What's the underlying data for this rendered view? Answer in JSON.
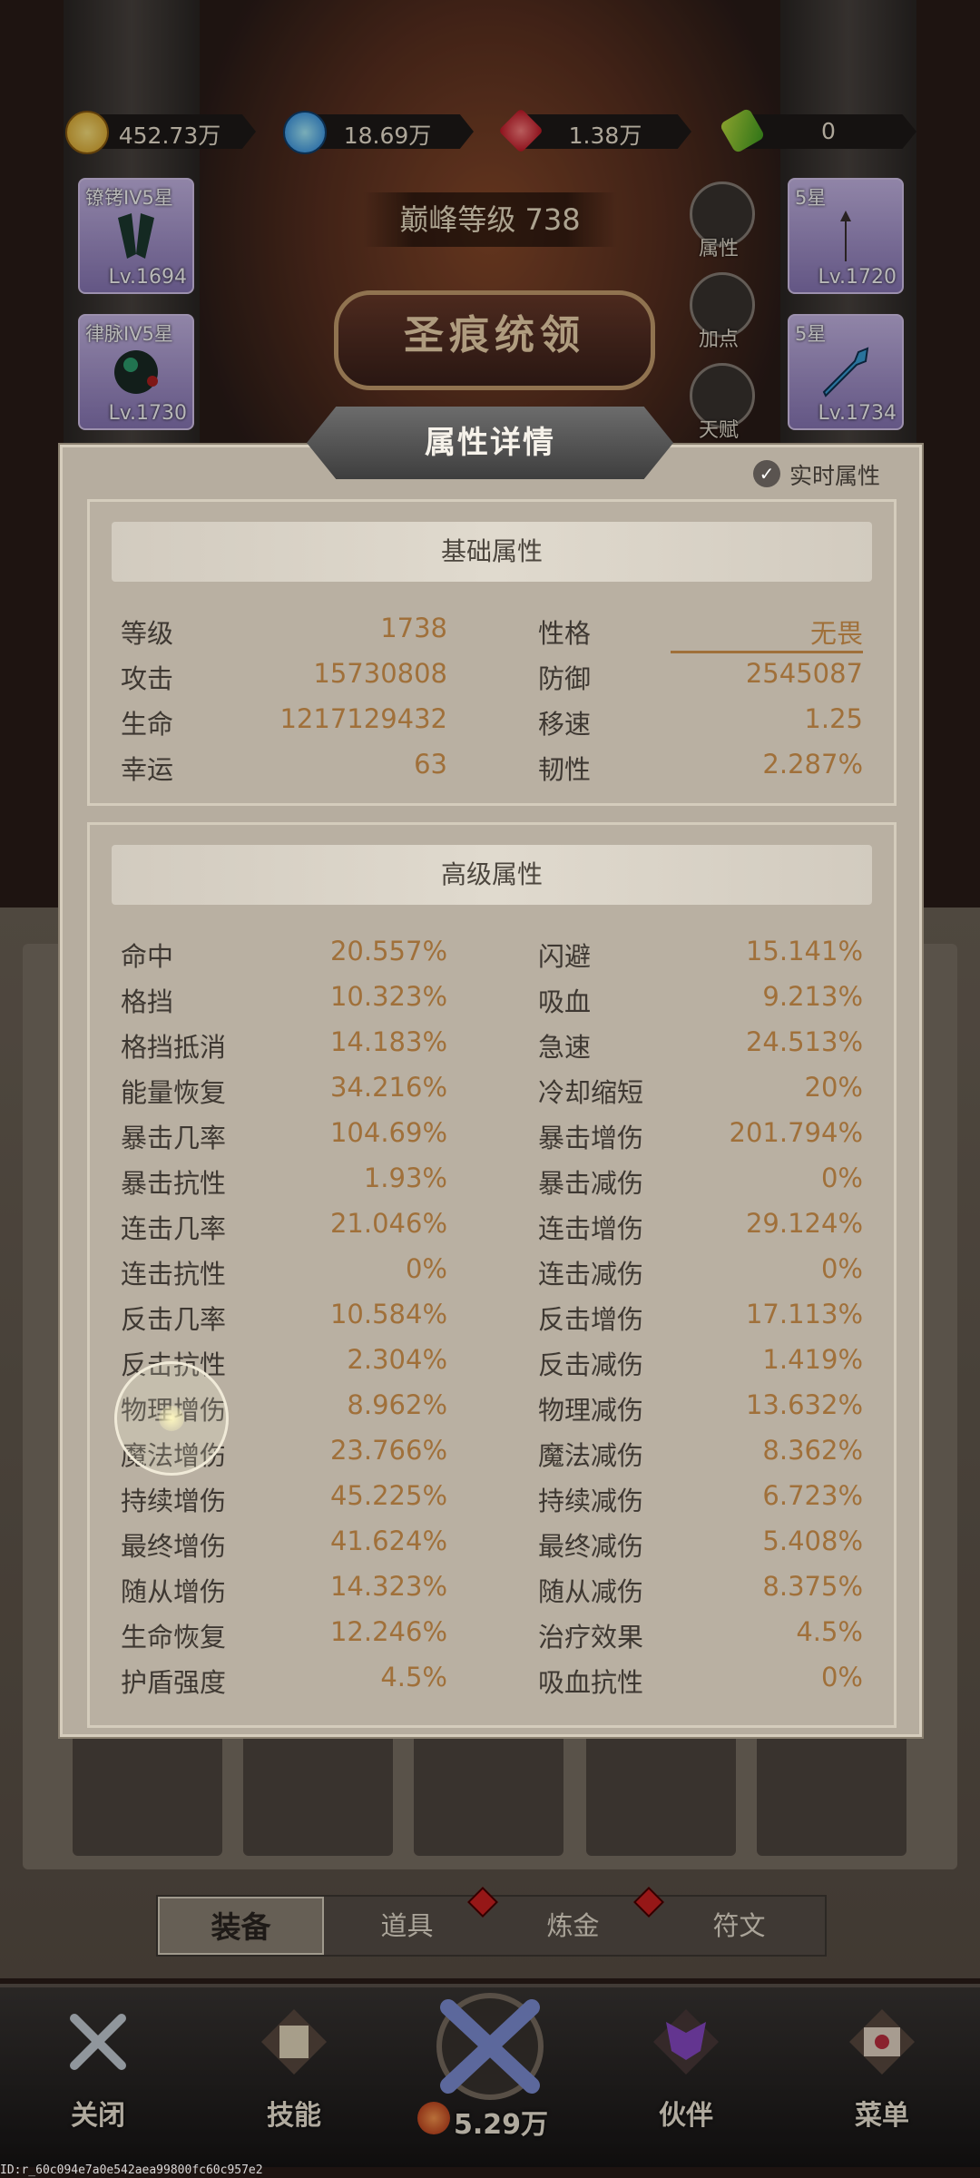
{
  "colors": {
    "panel_bg": "#b6ad9f",
    "value_text": "#a0703a",
    "label_text": "#3e3832",
    "tab_active": "#8e8476",
    "badge_red": "#d02020"
  },
  "currencies": [
    {
      "icon": "gold-coin-icon",
      "value": "452.73万"
    },
    {
      "icon": "blue-gem-icon",
      "value": "18.69万"
    },
    {
      "icon": "red-ruby-icon",
      "value": "1.38万"
    },
    {
      "icon": "green-ticket-icon",
      "value": "0"
    }
  ],
  "hero": {
    "peak_level": "巅峰等级 738",
    "title_badge": "圣痕统领",
    "gear_left": [
      {
        "title": "镣铐IV5星",
        "level": "Lv.1694"
      },
      {
        "title": "律脉IV5星",
        "level": "Lv.1730"
      }
    ],
    "gear_right": [
      {
        "title": "5星",
        "level": "Lv.1720"
      },
      {
        "title": "5星",
        "level": "Lv.1734"
      }
    ],
    "side_buttons": [
      {
        "label": "属性",
        "icon": "attribute-icon"
      },
      {
        "label": "加点",
        "icon": "fist-icon"
      },
      {
        "label": "天赋",
        "icon": "talent-tree-icon"
      }
    ]
  },
  "panel": {
    "title": "属性详情",
    "realtime_label": "实时属性",
    "basic": {
      "title": "基础属性",
      "rows": [
        {
          "k1": "等级",
          "v1": "1738",
          "k2": "性格",
          "v2": "无畏"
        },
        {
          "k1": "攻击",
          "v1": "15730808",
          "k2": "防御",
          "v2": "2545087"
        },
        {
          "k1": "生命",
          "v1": "1217129432",
          "k2": "移速",
          "v2": "1.25"
        },
        {
          "k1": "幸运",
          "v1": "63",
          "k2": "韧性",
          "v2": "2.287%"
        }
      ]
    },
    "advanced": {
      "title": "高级属性",
      "rows": [
        {
          "k1": "命中",
          "v1": "20.557%",
          "k2": "闪避",
          "v2": "15.141%"
        },
        {
          "k1": "格挡",
          "v1": "10.323%",
          "k2": "吸血",
          "v2": "9.213%"
        },
        {
          "k1": "格挡抵消",
          "v1": "14.183%",
          "k2": "急速",
          "v2": "24.513%"
        },
        {
          "k1": "能量恢复",
          "v1": "34.216%",
          "k2": "冷却缩短",
          "v2": "20%"
        },
        {
          "k1": "暴击几率",
          "v1": "104.69%",
          "k2": "暴击增伤",
          "v2": "201.794%"
        },
        {
          "k1": "暴击抗性",
          "v1": "1.93%",
          "k2": "暴击减伤",
          "v2": "0%"
        },
        {
          "k1": "连击几率",
          "v1": "21.046%",
          "k2": "连击增伤",
          "v2": "29.124%"
        },
        {
          "k1": "连击抗性",
          "v1": "0%",
          "k2": "连击减伤",
          "v2": "0%"
        },
        {
          "k1": "反击几率",
          "v1": "10.584%",
          "k2": "反击增伤",
          "v2": "17.113%"
        },
        {
          "k1": "反击抗性",
          "v1": "2.304%",
          "k2": "反击减伤",
          "v2": "1.419%"
        },
        {
          "k1": "物理增伤",
          "v1": "8.962%",
          "k2": "物理减伤",
          "v2": "13.632%"
        },
        {
          "k1": "魔法增伤",
          "v1": "23.766%",
          "k2": "魔法减伤",
          "v2": "8.362%"
        },
        {
          "k1": "持续增伤",
          "v1": "45.225%",
          "k2": "持续减伤",
          "v2": "6.723%"
        },
        {
          "k1": "最终增伤",
          "v1": "41.624%",
          "k2": "最终减伤",
          "v2": "5.408%"
        },
        {
          "k1": "随从增伤",
          "v1": "14.323%",
          "k2": "随从减伤",
          "v2": "8.375%"
        },
        {
          "k1": "生命恢复",
          "v1": "12.246%",
          "k2": "治疗效果",
          "v2": "4.5%"
        },
        {
          "k1": "护盾强度",
          "v1": "4.5%",
          "k2": "吸血抗性",
          "v2": "0%"
        }
      ]
    }
  },
  "tabs": [
    {
      "label": "装备",
      "active": true
    },
    {
      "label": "道具",
      "active": false
    },
    {
      "label": "炼金",
      "active": false
    },
    {
      "label": "符文",
      "active": false
    }
  ],
  "nav": {
    "close": "关闭",
    "skills": "技能",
    "center_value": "5.29万",
    "partners": "伙伴",
    "menu": "菜单"
  },
  "footer_id": "ID:r_60c094e7a0e542aea99800fc60c957e2"
}
